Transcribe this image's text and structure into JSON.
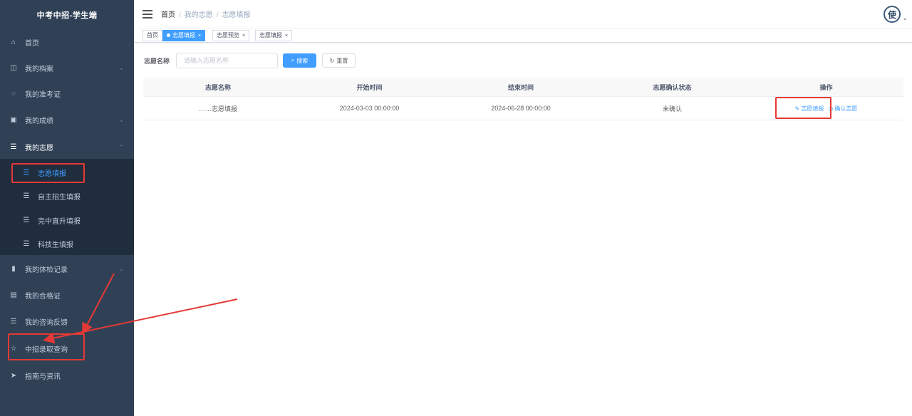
{
  "sidebar": {
    "title": "中考中招-学生端",
    "items": [
      {
        "icon": "home-icon",
        "glyph": "⌂",
        "label": "首页"
      },
      {
        "icon": "archive-icon",
        "glyph": "◫",
        "label": "我的档案",
        "chevron": "⌄"
      },
      {
        "icon": "ticket-icon",
        "glyph": "◌",
        "label": "我的准考证"
      },
      {
        "icon": "score-icon",
        "glyph": "▣",
        "label": "我的成绩",
        "chevron": "⌄"
      },
      {
        "icon": "document-icon",
        "glyph": "☰",
        "label": "我的志愿",
        "chevron": "⌃"
      },
      {
        "icon": "document-icon",
        "glyph": "☰",
        "label": "志愿填报"
      },
      {
        "icon": "document-icon",
        "glyph": "☰",
        "label": "自主招生填报"
      },
      {
        "icon": "document-icon",
        "glyph": "☰",
        "label": "完中直升填报"
      },
      {
        "icon": "document-icon",
        "glyph": "☰",
        "label": "科技生填报"
      },
      {
        "icon": "bar-chart-icon",
        "glyph": "▮",
        "label": "我的体检记录",
        "chevron": "⌄"
      },
      {
        "icon": "certificate-icon",
        "glyph": "▤",
        "label": "我的合格证"
      },
      {
        "icon": "feedback-icon",
        "glyph": "☰",
        "label": "我的咨询反馈"
      },
      {
        "icon": "star-icon",
        "glyph": "☆",
        "label": "中招录取查询"
      },
      {
        "icon": "send-icon",
        "glyph": "➤",
        "label": "指南与资讯"
      }
    ]
  },
  "navbar": {
    "breadcrumb": [
      "首页",
      "我的志愿",
      "志愿填报"
    ],
    "avatar_text": "使",
    "avatar_caret": "⌄"
  },
  "tags": [
    {
      "label": "首页",
      "active": false
    },
    {
      "label": "志愿填报",
      "active": true,
      "close": "×"
    },
    {
      "label": "志愿预览",
      "active": false,
      "close": "×"
    },
    {
      "label": "志愿填报",
      "active": false,
      "close": "×"
    }
  ],
  "search": {
    "label": "志愿名称",
    "placeholder": "请输入志愿名称",
    "search_button": "搜索",
    "search_icon": "⌕",
    "reset_button": "重置",
    "reset_icon": "↻"
  },
  "table": {
    "headers": [
      "志愿名称",
      "开始时间",
      "结束时间",
      "志愿确认状态",
      "操作"
    ],
    "rows": [
      {
        "name": "……志愿填报",
        "start": "2024-03-03 00:00:00",
        "end": "2024-06-28 00:00:00",
        "status": "未确认",
        "actions": [
          {
            "icon": "edit-icon",
            "glyph": "✎",
            "label": "志愿填报"
          },
          {
            "icon": "check-icon",
            "glyph": "◷",
            "label": "确认志愿"
          }
        ]
      }
    ]
  },
  "colors": {
    "sidebar_bg": "#304156",
    "submenu_bg": "#1f2d3d",
    "primary": "#409eff",
    "annotation": "#e53935"
  }
}
